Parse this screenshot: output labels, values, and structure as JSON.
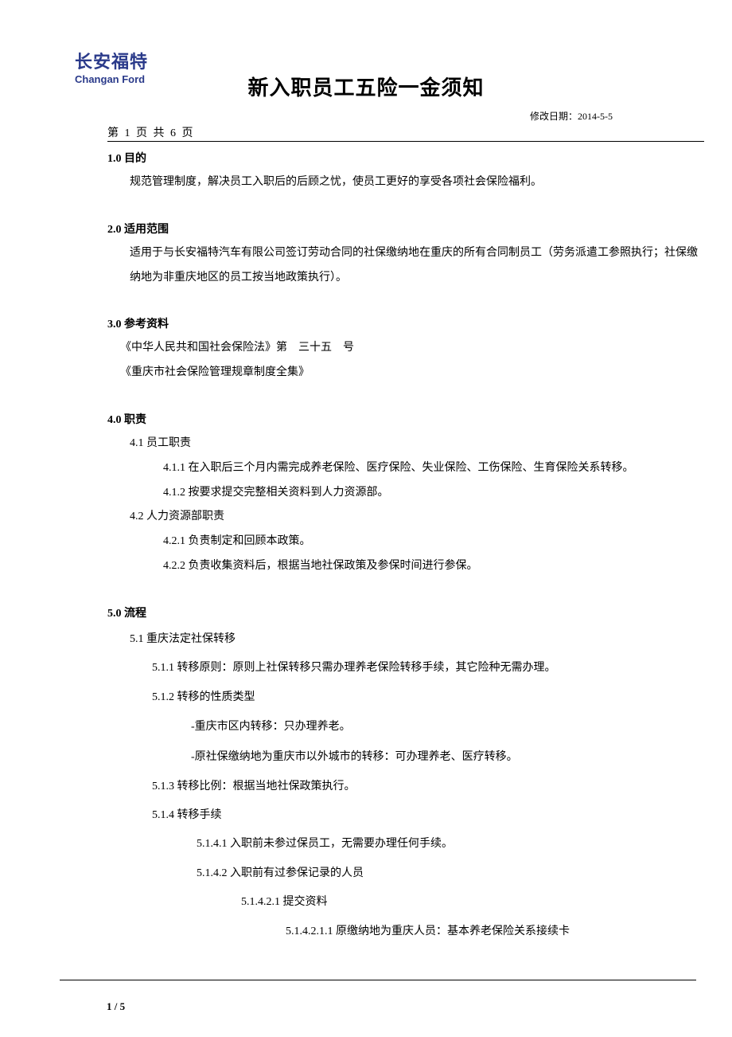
{
  "logo": {
    "cn": "长安福特",
    "en": "Changan Ford"
  },
  "title": "新入职员工五险一金须知",
  "revision_date_label": "修改日期：",
  "revision_date": "2014-5-5",
  "page_info": "第 1 页 共 6 页",
  "sections": {
    "s1": {
      "head": "1.0 目的",
      "body": "规范管理制度，解决员工入职后的后顾之忧，使员工更好的享受各项社会保险福利。"
    },
    "s2": {
      "head": "2.0 适用范围",
      "body": "适用于与长安福特汽车有限公司签订劳动合同的社保缴纳地在重庆的所有合同制员工（劳务派遣工参照执行；社保缴纳地为非重庆地区的员工按当地政策执行）。"
    },
    "s3": {
      "head": "3.0 参考资料",
      "ref1": "《中华人民共和国社会保险法》第　三十五　号",
      "ref2": "《重庆市社会保险管理规章制度全集》"
    },
    "s4": {
      "head": "4.0 职责",
      "s4_1": "4.1 员工职责",
      "s4_1_1": "4.1.1 在入职后三个月内需完成养老保险、医疗保险、失业保险、工伤保险、生育保险关系转移。",
      "s4_1_2": "4.1.2 按要求提交完整相关资料到人力资源部。",
      "s4_2": "4.2 人力资源部职责",
      "s4_2_1": "4.2.1 负责制定和回顾本政策。",
      "s4_2_2": "4.2.2 负责收集资料后，根据当地社保政策及参保时间进行参保。"
    },
    "s5": {
      "head": "5.0 流程",
      "s5_1": "5.1 重庆法定社保转移",
      "s5_1_1": "5.1.1 转移原则：原则上社保转移只需办理养老保险转移手续，其它险种无需办理。",
      "s5_1_2": "5.1.2 转移的性质类型",
      "s5_1_2_a": "-重庆市区内转移：只办理养老。",
      "s5_1_2_b": "-原社保缴纳地为重庆市以外城市的转移：可办理养老、医疗转移。",
      "s5_1_3": "5.1.3 转移比例：根据当地社保政策执行。",
      "s5_1_4": "5.1.4 转移手续",
      "s5_1_4_1": "5.1.4.1 入职前未参过保员工，无需要办理任何手续。",
      "s5_1_4_2": "5.1.4.2 入职前有过参保记录的人员",
      "s5_1_4_2_1": "5.1.4.2.1 提交资料",
      "s5_1_4_2_1_1": "5.1.4.2.1.1 原缴纳地为重庆人员：基本养老保险关系接续卡"
    }
  },
  "footer_page": "1 / 5"
}
